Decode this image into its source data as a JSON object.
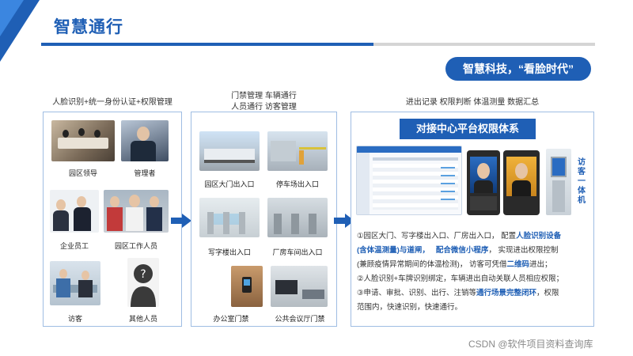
{
  "header": {
    "title": "智慧通行",
    "slogan": "智慧科技，“看脸时代”"
  },
  "captions": {
    "left": "人脸识别+统一身份认证+权限管理",
    "middle_line1": "门禁管理  车辆通行",
    "middle_line2": "人员通行  访客管理",
    "right": "进出记录  权限判断  体温测量  数据汇总"
  },
  "people": [
    {
      "label": "园区领导"
    },
    {
      "label": "管理者"
    },
    {
      "label": "企业员工"
    },
    {
      "label": "园区工作人员"
    },
    {
      "label": "访客"
    },
    {
      "label": "其他人员"
    }
  ],
  "entrances": [
    {
      "label": "园区大门出入口"
    },
    {
      "label": "停车场出入口"
    },
    {
      "label": "写字楼出入口"
    },
    {
      "label": "厂房车间出入口"
    },
    {
      "label": "办公室门禁"
    },
    {
      "label": "公共会议厅门禁"
    }
  ],
  "platform": {
    "banner": "对接中心平台权限体系",
    "visitor_kiosk": "访客一体机",
    "desc": {
      "l1_a": "①园区大门、写字楼出入口、厂房出入口，  配置",
      "l1_hl": "人脸识别设备",
      "l2_hl1": "(含体温测量)与道闸，",
      "l2_hl2": "配合微信小程序",
      "l2_b": "，  实现进出权限控制",
      "l3_a": "(兼顾疫情异常期间的体温检测)，  访客可凭借",
      "l3_hl": "二维码",
      "l3_b": "进出；",
      "l4": "②人脸识别+车牌识别绑定，车辆进出自动关联人员相应权限；",
      "l5_a": "③申请、审批、识别、出行、注销等",
      "l5_hl": "通行场景完整闭环",
      "l5_b": "，权限",
      "l6": "范围内，快速识别，快速通行。"
    }
  },
  "watermark": "CSDN @软件项目资料查询库",
  "colors": {
    "brand": "#1f5fb5",
    "accent": "#3b86e0"
  }
}
